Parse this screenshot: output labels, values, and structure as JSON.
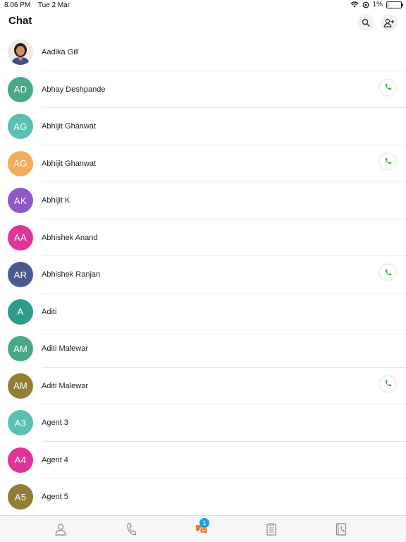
{
  "status_bar": {
    "time": "8:06 PM",
    "date": "Tue 2 Mar",
    "battery": "1%",
    "battery_level": 0.01
  },
  "header": {
    "title": "Chat",
    "search_icon": "search-icon",
    "add_contact_icon": "add-contact-icon"
  },
  "contacts": [
    {
      "name": "Aadika Gill",
      "initials": "",
      "photo": true,
      "color": "#efe9e4",
      "call": false
    },
    {
      "name": "Abhay Deshpande",
      "initials": "AD",
      "color": "#4aa88a",
      "call": true
    },
    {
      "name": "Abhijit Ghanwat",
      "initials": "AG",
      "color": "#5bbfb3",
      "call": false
    },
    {
      "name": "Abhijit Ghanwat",
      "initials": "AG",
      "color": "#f2ad5c",
      "call": true
    },
    {
      "name": "Abhijit K",
      "initials": "AK",
      "color": "#8e58c7",
      "call": false
    },
    {
      "name": "Abhishek Anand",
      "initials": "AA",
      "color": "#e0349a",
      "call": false
    },
    {
      "name": "Abhishek Ranjan",
      "initials": "AR",
      "color": "#4a5a8c",
      "call": true
    },
    {
      "name": "Aditi",
      "initials": "A",
      "color": "#2e9c8c",
      "call": false
    },
    {
      "name": "Aditi Malewar",
      "initials": "AM",
      "color": "#4aa88a",
      "call": false
    },
    {
      "name": "Aditi Malewar",
      "initials": "AM",
      "color": "#947d35",
      "call": true
    },
    {
      "name": "Agent 3",
      "initials": "A3",
      "color": "#5bbfb3",
      "call": false
    },
    {
      "name": "Agent 4",
      "initials": "A4",
      "color": "#e0349a",
      "call": false
    },
    {
      "name": "Agent 5",
      "initials": "A5",
      "color": "#947d35",
      "call": false
    }
  ],
  "tabs": [
    {
      "name": "tab-contacts",
      "icon": "person-icon"
    },
    {
      "name": "tab-calls",
      "icon": "phone-outline-icon"
    },
    {
      "name": "tab-chat",
      "icon": "chat-bubbles-icon",
      "badge": "1",
      "active": true
    },
    {
      "name": "tab-notes",
      "icon": "notes-icon"
    },
    {
      "name": "tab-directory",
      "icon": "phonebook-icon"
    }
  ],
  "colors": {
    "accent": "#1fa3d8",
    "chat_active": "#f0772b",
    "call_green": "#3aa53a",
    "tab_icon": "#8a8a8a"
  }
}
